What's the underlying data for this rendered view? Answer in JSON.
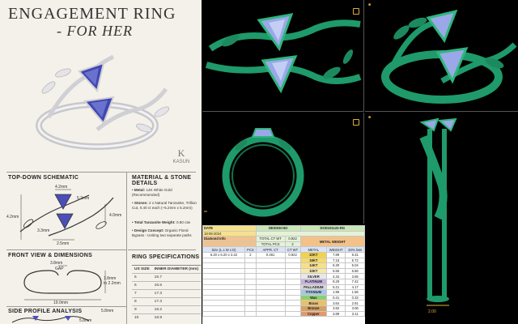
{
  "sheet": {
    "title_line1": "ENGAGEMENT RING",
    "title_line2": "- FOR HER",
    "brand": "KASUN",
    "sections": {
      "top_down": "TOP-DOWN SCHEMATIC",
      "material": "MATERIAL & STONE DETAILS",
      "front": "FRONT VIEW & DIMENSIONS",
      "ring_specs": "RING SPECIFICATIONS",
      "side": "SIDE PROFILE ANALYSIS"
    },
    "top_dims": {
      "d1": "4.2mm",
      "d2": "5.2mm",
      "d3": "4.2mm",
      "d4": "3.3mm",
      "d5": "4.0mm",
      "d6": "2.5mm"
    },
    "front_dims": {
      "gap_value": "3.8mm",
      "gap_label": "GAP",
      "height": "1.8mm\nto 2.2mm",
      "width": "19.0mm"
    },
    "side_dims": {
      "d1": "5.8mm",
      "d2": "5.8mm"
    },
    "material_lines": [
      {
        "label": "Metal:",
        "text": " 14K White Gold (Recommended)"
      },
      {
        "label": "Stones:",
        "text": " 2 x Natural Tanzanite, Trillion Cut, 0.40 ct each (~5.2mm x 5.2mm)"
      },
      {
        "label": "Total Tanzanite Weight:",
        "text": " 0.80 ctw"
      },
      {
        "label": "Design Concept:",
        "text": " Organic Floral Bypass - Uniting two separate paths"
      }
    ],
    "spec_table": {
      "headers": [
        "US SIZE",
        "INNER DIAMETER (mm)"
      ],
      "rows": [
        [
          "5",
          "15.7"
        ],
        [
          "6",
          "16.5"
        ],
        [
          "7",
          "17.3"
        ],
        [
          "8",
          "17.3"
        ],
        [
          "9",
          "18.2"
        ],
        [
          "10",
          "18.9"
        ]
      ]
    }
  },
  "viewports": {
    "side_scale_label": "2.00"
  },
  "info_table": {
    "date_label": "DATE",
    "date_value": "18-06-2024",
    "design_no_label": "DESIGN NO",
    "design_no_value": "DOD101122-RG",
    "diamond_info": "Diamond Info",
    "total_ct_label": "TOTAL CT WT",
    "total_ct_value": "0.922",
    "total_pcs_label": "TOTAL PCS",
    "total_pcs_value": "2",
    "metal_weight_label": "METAL WEIGHT",
    "col_headers": [
      "Size (L x W x D)",
      "PCS",
      "APPR. CT",
      "CT WT",
      "METAL",
      "WEIGHT",
      "20% loss"
    ],
    "stone_row": [
      "5.20 x 5.20 x 3.22",
      "2",
      "0.461",
      "0.922"
    ],
    "metals": [
      {
        "name": "22KT",
        "weight": "7.89",
        "loss": "9.31",
        "cls": "m-22"
      },
      {
        "name": "18KT",
        "weight": "7.15",
        "loss": "5.72",
        "cls": "m-18"
      },
      {
        "name": "14KT",
        "weight": "6.30",
        "loss": "5.04",
        "cls": "m-14"
      },
      {
        "name": "10KT",
        "weight": "5.56",
        "loss": "6.66",
        "cls": "m-10"
      },
      {
        "name": "SILVER",
        "weight": "4.34",
        "loss": "3.65",
        "cls": "m-silver"
      },
      {
        "name": "PLATINUM",
        "weight": "9.29",
        "loss": "7.42",
        "cls": "m-plat"
      },
      {
        "name": "PALLADIUM",
        "weight": "5.21",
        "loss": "4.17",
        "cls": "m-pall"
      },
      {
        "name": "TITANIUM",
        "weight": "1.95",
        "loss": "1.56",
        "cls": "m-tit"
      },
      {
        "name": "Wax",
        "weight": "0.41",
        "loss": "0.33",
        "cls": "m-wax"
      },
      {
        "name": "Brass",
        "weight": "3.64",
        "loss": "2.91",
        "cls": "m-brass"
      },
      {
        "name": "Bronze",
        "weight": "3.82",
        "loss": "3.06",
        "cls": "m-bronze"
      },
      {
        "name": "Copper",
        "weight": "3.89",
        "loss": "3.11",
        "cls": "m-copper"
      }
    ]
  },
  "colors": {
    "cad_green": "#1f9a6a",
    "stone": "#9aa8e8",
    "tanzanite": "#4a4fb8"
  }
}
